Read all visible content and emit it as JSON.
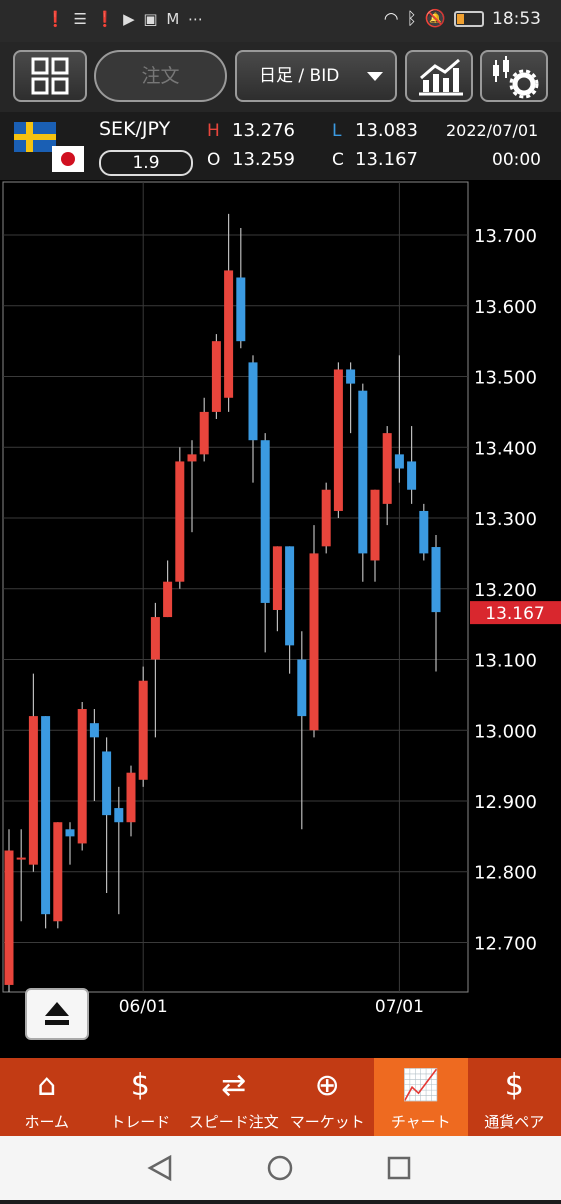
{
  "status_bar": {
    "left_icons": [
      "alert-icon",
      "wifi-icon",
      "alert-icon",
      "youtube-icon",
      "app-icon",
      "gmail-icon",
      "more-icon"
    ],
    "time": "18:53",
    "battery_level": 0.3
  },
  "toolbar": {
    "order_label": "注文",
    "timeframe_label": "日足 / BID"
  },
  "instrument": {
    "symbol": "SEK/JPY",
    "spread": "1.9",
    "high_label": "H",
    "high": "13.276",
    "low_label": "L",
    "low": "13.083",
    "open_label": "O",
    "open": "13.259",
    "close_label": "C",
    "close": "13.167",
    "date": "2022/07/01",
    "time": "00:00"
  },
  "chart_data": {
    "type": "candlestick",
    "ylim": [
      12.63,
      13.775
    ],
    "y_ticks": [
      "13.700",
      "13.600",
      "13.500",
      "13.400",
      "13.300",
      "13.200",
      "13.100",
      "13.000",
      "12.900",
      "12.800",
      "12.700"
    ],
    "x_ticks": [
      {
        "label": "06/01",
        "index": 11
      },
      {
        "label": "07/01",
        "index": 32
      }
    ],
    "current_price": "13.167",
    "colors": {
      "up": "#e8453c",
      "down": "#3b9ae1"
    },
    "candles": [
      {
        "o": 12.64,
        "h": 12.86,
        "l": 12.63,
        "c": 12.83
      },
      {
        "o": 12.82,
        "h": 12.86,
        "l": 12.73,
        "c": 12.82
      },
      {
        "o": 12.81,
        "h": 13.08,
        "l": 12.8,
        "c": 13.02
      },
      {
        "o": 13.02,
        "h": 13.02,
        "l": 12.72,
        "c": 12.74
      },
      {
        "o": 12.73,
        "h": 12.87,
        "l": 12.72,
        "c": 12.87
      },
      {
        "o": 12.86,
        "h": 12.87,
        "l": 12.81,
        "c": 12.85
      },
      {
        "o": 12.84,
        "h": 13.04,
        "l": 12.83,
        "c": 13.03
      },
      {
        "o": 13.01,
        "h": 13.03,
        "l": 12.9,
        "c": 12.99
      },
      {
        "o": 12.97,
        "h": 12.99,
        "l": 12.77,
        "c": 12.88
      },
      {
        "o": 12.89,
        "h": 12.92,
        "l": 12.74,
        "c": 12.87
      },
      {
        "o": 12.87,
        "h": 12.95,
        "l": 12.85,
        "c": 12.94
      },
      {
        "o": 12.93,
        "h": 13.09,
        "l": 12.92,
        "c": 13.07
      },
      {
        "o": 13.1,
        "h": 13.18,
        "l": 12.99,
        "c": 13.16
      },
      {
        "o": 13.16,
        "h": 13.24,
        "l": 13.16,
        "c": 13.21
      },
      {
        "o": 13.21,
        "h": 13.4,
        "l": 13.2,
        "c": 13.38
      },
      {
        "o": 13.38,
        "h": 13.41,
        "l": 13.28,
        "c": 13.39
      },
      {
        "o": 13.39,
        "h": 13.47,
        "l": 13.38,
        "c": 13.45
      },
      {
        "o": 13.45,
        "h": 13.56,
        "l": 13.44,
        "c": 13.55
      },
      {
        "o": 13.47,
        "h": 13.73,
        "l": 13.45,
        "c": 13.65
      },
      {
        "o": 13.64,
        "h": 13.71,
        "l": 13.54,
        "c": 13.55
      },
      {
        "o": 13.52,
        "h": 13.53,
        "l": 13.35,
        "c": 13.41
      },
      {
        "o": 13.41,
        "h": 13.42,
        "l": 13.11,
        "c": 13.18
      },
      {
        "o": 13.17,
        "h": 13.26,
        "l": 13.14,
        "c": 13.26
      },
      {
        "o": 13.26,
        "h": 13.26,
        "l": 13.08,
        "c": 13.12
      },
      {
        "o": 13.1,
        "h": 13.14,
        "l": 12.86,
        "c": 13.02
      },
      {
        "o": 13.0,
        "h": 13.29,
        "l": 12.99,
        "c": 13.25
      },
      {
        "o": 13.26,
        "h": 13.35,
        "l": 13.25,
        "c": 13.34
      },
      {
        "o": 13.31,
        "h": 13.52,
        "l": 13.3,
        "c": 13.51
      },
      {
        "o": 13.51,
        "h": 13.52,
        "l": 13.42,
        "c": 13.49
      },
      {
        "o": 13.48,
        "h": 13.49,
        "l": 13.21,
        "c": 13.25
      },
      {
        "o": 13.24,
        "h": 13.34,
        "l": 13.21,
        "c": 13.34
      },
      {
        "o": 13.32,
        "h": 13.43,
        "l": 13.29,
        "c": 13.42
      },
      {
        "o": 13.39,
        "h": 13.53,
        "l": 13.35,
        "c": 13.37
      },
      {
        "o": 13.38,
        "h": 13.43,
        "l": 13.32,
        "c": 13.34
      },
      {
        "o": 13.31,
        "h": 13.32,
        "l": 13.24,
        "c": 13.25
      },
      {
        "o": 13.259,
        "h": 13.276,
        "l": 13.083,
        "c": 13.167
      }
    ]
  },
  "bottom_nav": [
    {
      "label": "ホーム",
      "icon": "home-icon"
    },
    {
      "label": "トレード",
      "icon": "trade-icon"
    },
    {
      "label": "スピード注文",
      "icon": "speed-order-icon"
    },
    {
      "label": "マーケット",
      "icon": "globe-icon"
    },
    {
      "label": "チャート",
      "icon": "chart-icon",
      "active": true
    },
    {
      "label": "通貨ペア",
      "icon": "currency-pair-icon"
    }
  ]
}
